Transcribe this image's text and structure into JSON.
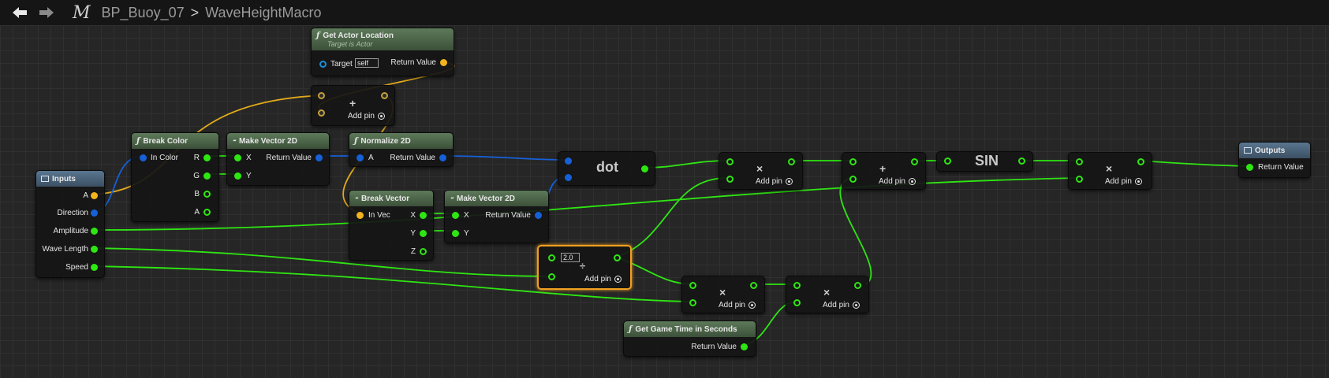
{
  "topbar": {
    "back_icon": "arrow-left-icon",
    "forward_icon": "arrow-right-icon",
    "macro_symbol": "M",
    "breadcrumb": [
      "BP_Buoy_07",
      "WaveHeightMacro"
    ],
    "separator": ">"
  },
  "colors": {
    "exec_vector": "#f3b31c",
    "float": "#2ee612",
    "vector2d": "#1660d8",
    "selected": "#f0a020"
  },
  "nodes": {
    "inputs": {
      "title": "Inputs",
      "pins": [
        "A",
        "Direction",
        "Amplitude",
        "Wave Length",
        "Speed"
      ]
    },
    "get_actor_location": {
      "title": "Get Actor Location",
      "subtitle": "Target is Actor",
      "target_label": "Target",
      "target_value": "self",
      "return_label": "Return Value"
    },
    "add_top": {
      "symbol": "+",
      "add_pin": "Add pin"
    },
    "break_color": {
      "title": "Break Color",
      "in_label": "In Color",
      "outs": [
        "R",
        "G",
        "B",
        "A"
      ]
    },
    "make_vector2d_1": {
      "title": "Make Vector 2D",
      "ins": [
        "X",
        "Y"
      ],
      "return_label": "Return Value"
    },
    "normalize2d": {
      "title": "Normalize 2D",
      "in_label": "A",
      "return_label": "Return Value"
    },
    "break_vector": {
      "title": "Break Vector",
      "in_label": "In Vec",
      "outs": [
        "X",
        "Y",
        "Z"
      ]
    },
    "make_vector2d_2": {
      "title": "Make Vector 2D",
      "ins": [
        "X",
        "Y"
      ],
      "return_label": "Return Value"
    },
    "dot": {
      "title": "dot"
    },
    "mul1": {
      "symbol": "×",
      "add_pin": "Add pin"
    },
    "add2": {
      "symbol": "+",
      "add_pin": "Add pin"
    },
    "sin": {
      "title": "SIN"
    },
    "mul_final": {
      "symbol": "×",
      "add_pin": "Add pin"
    },
    "outputs": {
      "title": "Outputs",
      "return_label": "Return Value"
    },
    "div": {
      "value": "2.0",
      "symbol": "÷",
      "add_pin": "Add pin"
    },
    "mul2": {
      "symbol": "×",
      "add_pin": "Add pin"
    },
    "mul3": {
      "symbol": "×",
      "add_pin": "Add pin"
    },
    "game_time": {
      "title": "Get Game Time in Seconds",
      "return_label": "Return Value"
    }
  }
}
